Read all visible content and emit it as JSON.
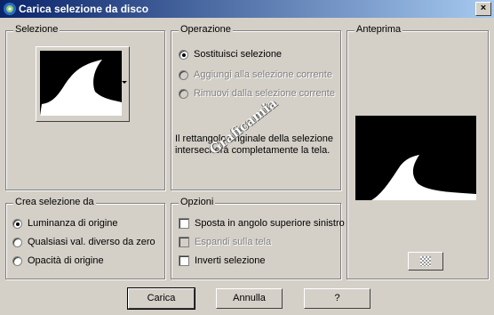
{
  "window": {
    "title": "Carica selezione da disco",
    "close_label": "×",
    "icon": "paint-shop-icon"
  },
  "selezione": {
    "label": "Selezione",
    "dropdown_icon": "dropdown-arrow-icon"
  },
  "operazione": {
    "label": "Operazione",
    "options": [
      {
        "label": "Sostituisci selezione",
        "selected": true,
        "enabled": true
      },
      {
        "label": "Aggiungi alla selezione corrente",
        "selected": false,
        "enabled": false
      },
      {
        "label": "Rimuovi dalla selezione corrente",
        "selected": false,
        "enabled": false
      }
    ],
    "note": "Il rettangolo originale della selezione intersecherà completamente la tela."
  },
  "anteprima": {
    "label": "Anteprima",
    "checker_icon": "transparency-checker-icon"
  },
  "crea": {
    "label": "Crea selezione da",
    "options": [
      {
        "label": "Luminanza di origine",
        "selected": true
      },
      {
        "label": "Qualsiasi val. diverso da zero",
        "selected": false
      },
      {
        "label": "Opacità di origine",
        "selected": false
      }
    ]
  },
  "opzioni": {
    "label": "Opzioni",
    "options": [
      {
        "label": "Sposta in angolo superiore sinistro",
        "checked": false,
        "enabled": true
      },
      {
        "label": "Espandi sulla tela",
        "checked": false,
        "enabled": false
      },
      {
        "label": "Inverti selezione",
        "checked": false,
        "enabled": true
      }
    ]
  },
  "buttons": {
    "ok": "Carica",
    "cancel": "Annulla",
    "help": "?"
  },
  "watermark": "Graficamia",
  "colors": {
    "title_start": "#0a246a",
    "title_end": "#a6caf0",
    "face": "#d4d0c8"
  }
}
